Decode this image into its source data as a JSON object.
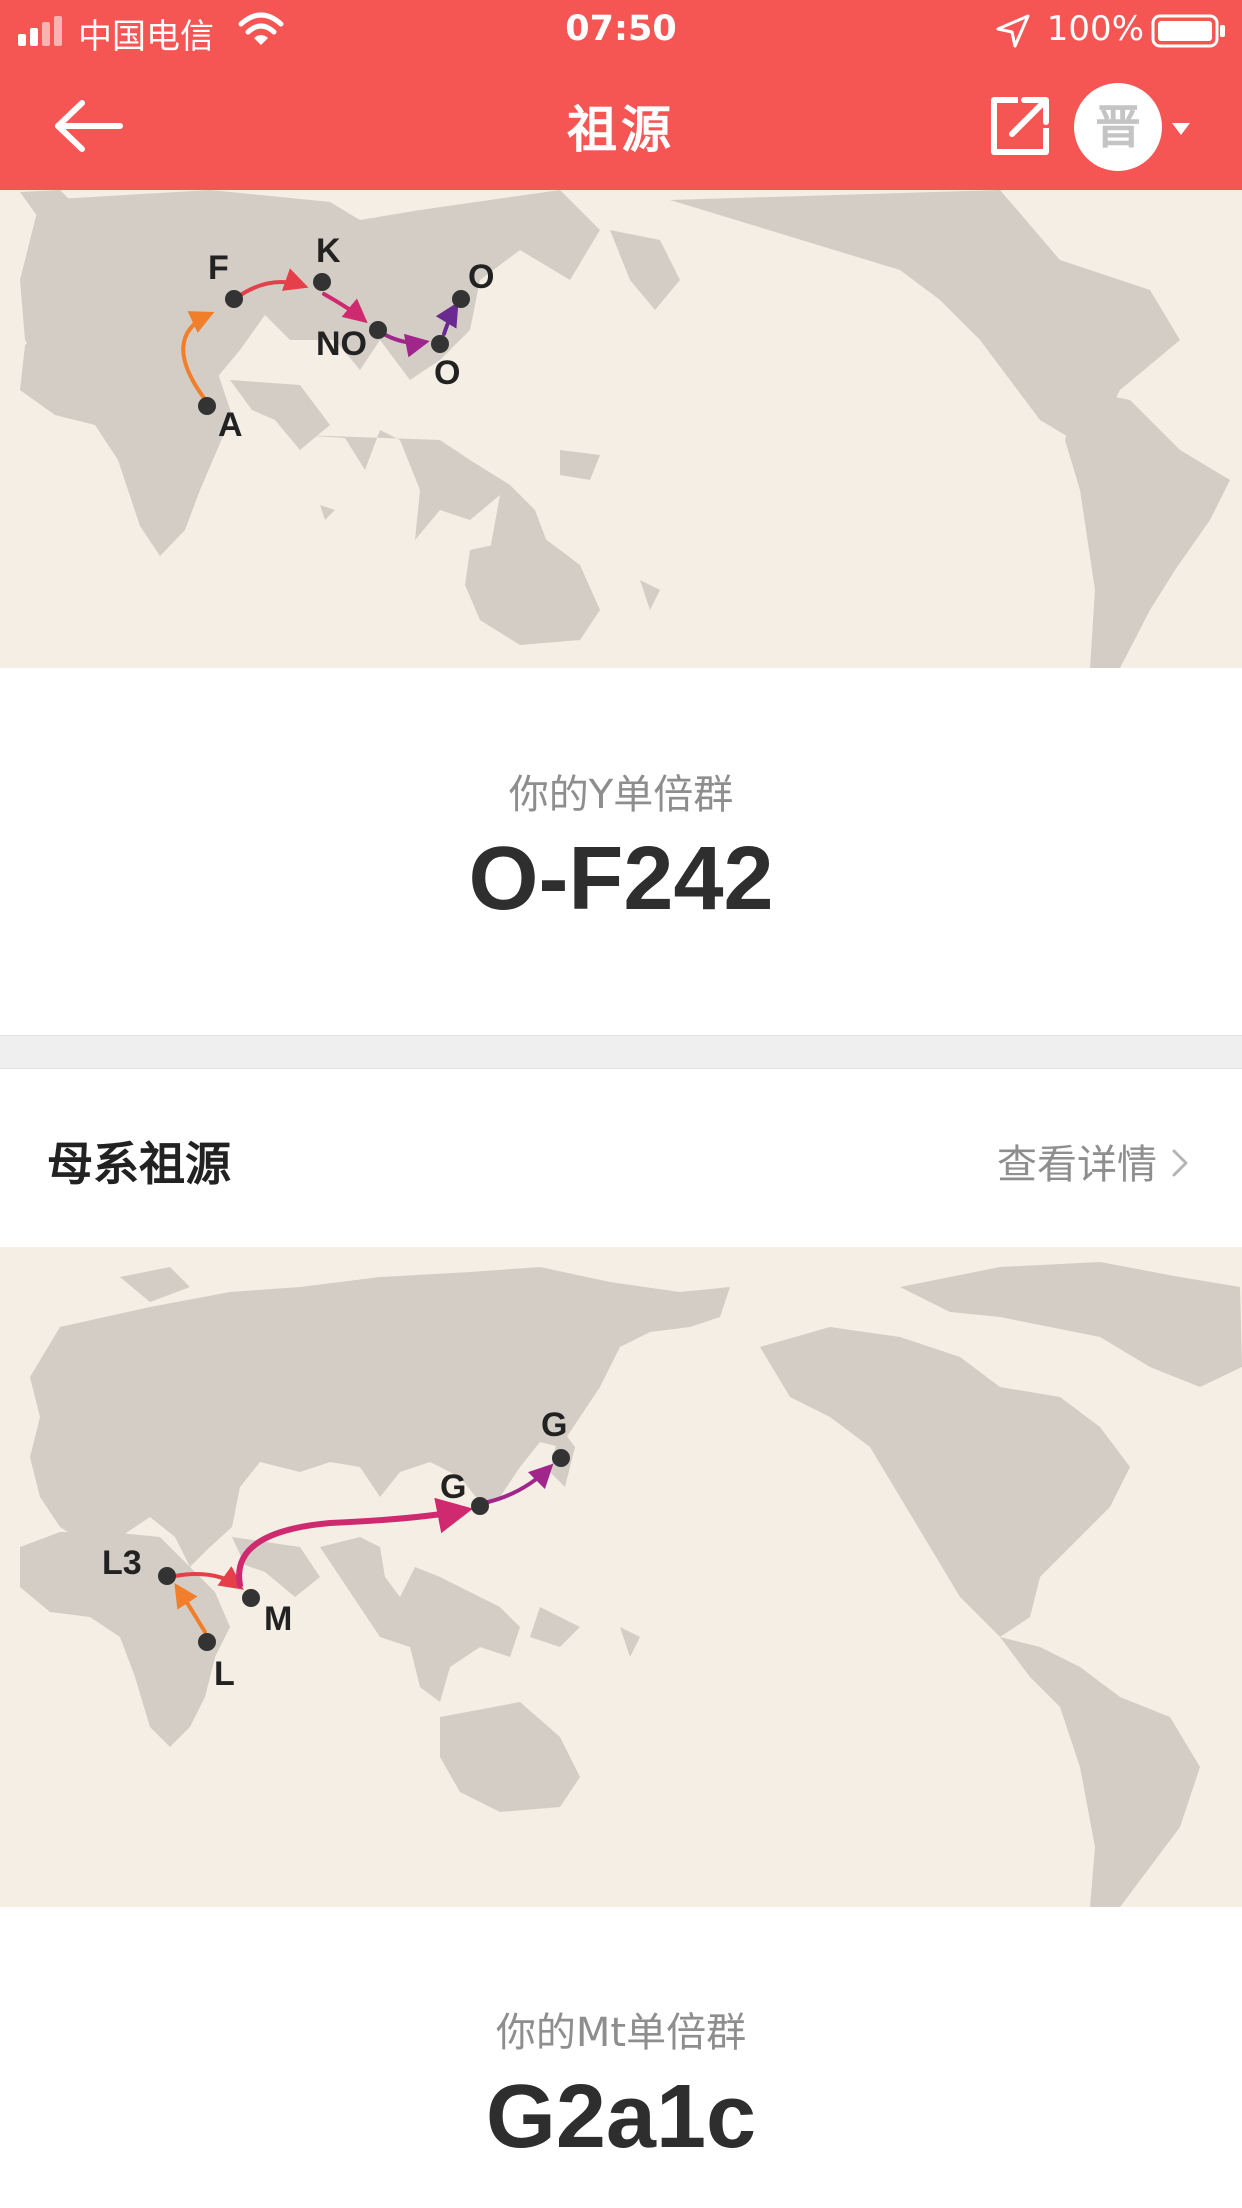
{
  "status_bar": {
    "carrier": "中国电信",
    "time": "07:50",
    "battery_percent": "100%"
  },
  "header": {
    "title": "祖源",
    "avatar_char": "晋"
  },
  "icons": {
    "back": "arrow-left-icon",
    "share": "external-share-icon",
    "dropdown": "caret-down-icon",
    "chevron": "chevron-right-icon"
  },
  "colors": {
    "brand": "#f55654",
    "map_background": "#f4eee4",
    "land": "#d3cdc5"
  },
  "paternal": {
    "map_labels": {
      "a": "A",
      "f": "F",
      "k": "K",
      "no": "NO",
      "o1": "O",
      "o2": "O"
    },
    "haplogroup_label": "你的Y单倍群",
    "haplogroup_value": "O-F242"
  },
  "maternal": {
    "section_title": "母系祖源",
    "details_link": "查看详情",
    "map_labels": {
      "l": "L",
      "l3": "L3",
      "m": "M",
      "g1": "G",
      "g2": "G"
    },
    "haplogroup_label": "你的Mt单倍群",
    "haplogroup_value": "G2a1c"
  }
}
